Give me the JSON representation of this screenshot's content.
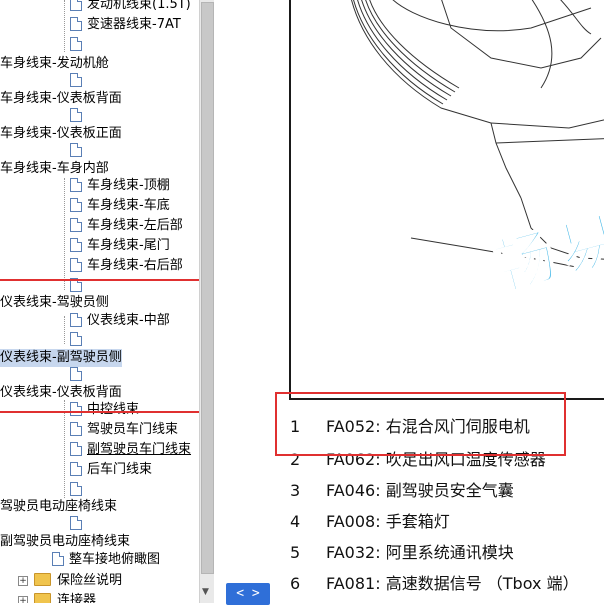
{
  "tree": {
    "items": [
      {
        "label": "发动机线束(1.5T)",
        "icon": "document-icon"
      },
      {
        "label": "变速器线束-7AT",
        "icon": "document-icon"
      },
      {
        "label": "",
        "icon": "document-icon"
      },
      {
        "label": "车身线束-发动机舱"
      },
      {
        "label": "",
        "icon": "document-icon"
      },
      {
        "label": "车身线束-仪表板背面"
      },
      {
        "label": "",
        "icon": "document-icon"
      },
      {
        "label": "车身线束-仪表板正面"
      },
      {
        "label": "",
        "icon": "document-icon"
      },
      {
        "label": "车身线束-车身内部"
      },
      {
        "label": "车身线束-顶棚",
        "icon": "document-icon"
      },
      {
        "label": "车身线束-车底",
        "icon": "document-icon"
      },
      {
        "label": "车身线束-左后部",
        "icon": "document-icon"
      },
      {
        "label": "车身线束-尾门",
        "icon": "document-icon"
      },
      {
        "label": "车身线束-右后部",
        "icon": "document-icon"
      },
      {
        "label": "",
        "icon": "document-icon"
      },
      {
        "label": "仪表线束-驾驶员侧"
      },
      {
        "label": "仪表线束-中部",
        "icon": "document-icon"
      },
      {
        "label": "",
        "icon": "document-icon"
      },
      {
        "label": "仪表线束-副驾驶员侧",
        "selected": true
      },
      {
        "label": "",
        "icon": "document-icon"
      },
      {
        "label": "仪表线束-仪表板背面"
      },
      {
        "label": "中控线束",
        "icon": "document-icon"
      },
      {
        "label": "驾驶员车门线束",
        "icon": "document-icon"
      },
      {
        "label": "副驾驶员车门线束",
        "icon": "document-icon"
      },
      {
        "label": "后车门线束",
        "icon": "document-icon"
      },
      {
        "label": "",
        "icon": "document-icon"
      },
      {
        "label": "驾驶员电动座椅线束"
      },
      {
        "label": "",
        "icon": "document-icon"
      },
      {
        "label": "副驾驶员电动座椅线束"
      },
      {
        "label": "整车接地俯瞰图",
        "icon": "document-icon"
      },
      {
        "label": "保险丝说明",
        "icon": "folder-icon"
      },
      {
        "label": "连接器",
        "icon": "folder-icon"
      }
    ]
  },
  "drawing": {
    "watermark": "畅易汽"
  },
  "legend": [
    {
      "num": "1",
      "text": "FA052: 右混合风门伺服电机"
    },
    {
      "num": "2",
      "text": "FA062: 吹足出风口温度传感器"
    },
    {
      "num": "3",
      "text": "FA046: 副驾驶员安全气囊"
    },
    {
      "num": "4",
      "text": "FA008: 手套箱灯"
    },
    {
      "num": "5",
      "text": "FA032: 阿里系统通讯模块"
    },
    {
      "num": "6",
      "text": "FA081: 高速数据信号 （Tbox 端）"
    }
  ],
  "nav": {
    "label": "< >"
  },
  "colors": {
    "highlight_box": "#e03030",
    "selection": "#c7d7ee",
    "nav_button": "#2f6fd8",
    "watermark": "#3db5e6"
  }
}
